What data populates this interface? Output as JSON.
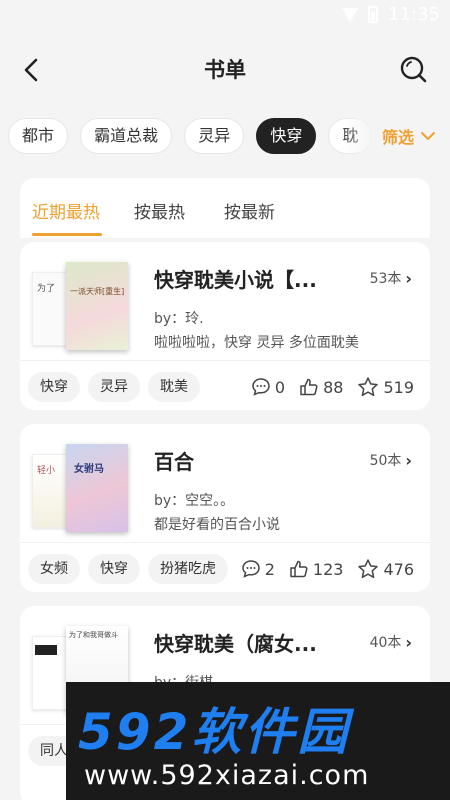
{
  "status": {
    "time": "11:35"
  },
  "header": {
    "title": "书单"
  },
  "categories": [
    "都市",
    "霸道总裁",
    "灵异",
    "快穿",
    "耽"
  ],
  "filter": {
    "label": "筛选"
  },
  "tabs": [
    "近期最热",
    "按最热",
    "按最新"
  ],
  "booklists": [
    {
      "title": "快穿耽美小说【...",
      "count": "53本",
      "author": "by：玲.",
      "desc": "啦啦啦啦，快穿 灵异  多位面耽美",
      "tags": [
        "快穿",
        "灵异",
        "耽美"
      ],
      "comments": "0",
      "likes": "88",
      "stars": "519",
      "cover_text": "为了",
      "cover_front_text": "一派天师[重生]",
      "cover_colors": [
        "#d9e8c4",
        "#f6d8d8"
      ]
    },
    {
      "title": "百合",
      "count": "50本",
      "author": "by：空空。。",
      "desc": "都是好看的百合小说",
      "tags": [
        "女频",
        "快穿",
        "扮猪吃虎"
      ],
      "comments": "2",
      "likes": "123",
      "stars": "476",
      "cover_text": "轻小",
      "cover_front_text": "女驸马",
      "cover_colors": [
        "#c9d7f0",
        "#f0c9d8"
      ]
    },
    {
      "title": "快穿耽美（腐女...",
      "count": "40本",
      "author": "by：街棋",
      "desc": "",
      "tags": [
        "同人"
      ],
      "comments": "",
      "likes": "",
      "stars": "",
      "cover_text": "为了",
      "cover_front_text": "为了和我哥做斗",
      "cover_colors": [
        "#f3f3f3",
        "#ffffff"
      ]
    }
  ],
  "watermark": {
    "brand": "592软件园",
    "url": "www.592xiazai.com"
  },
  "colors": {
    "accent": "#f0a030",
    "brand_blue": "#1f7ef0",
    "active_chip": "#222222"
  }
}
